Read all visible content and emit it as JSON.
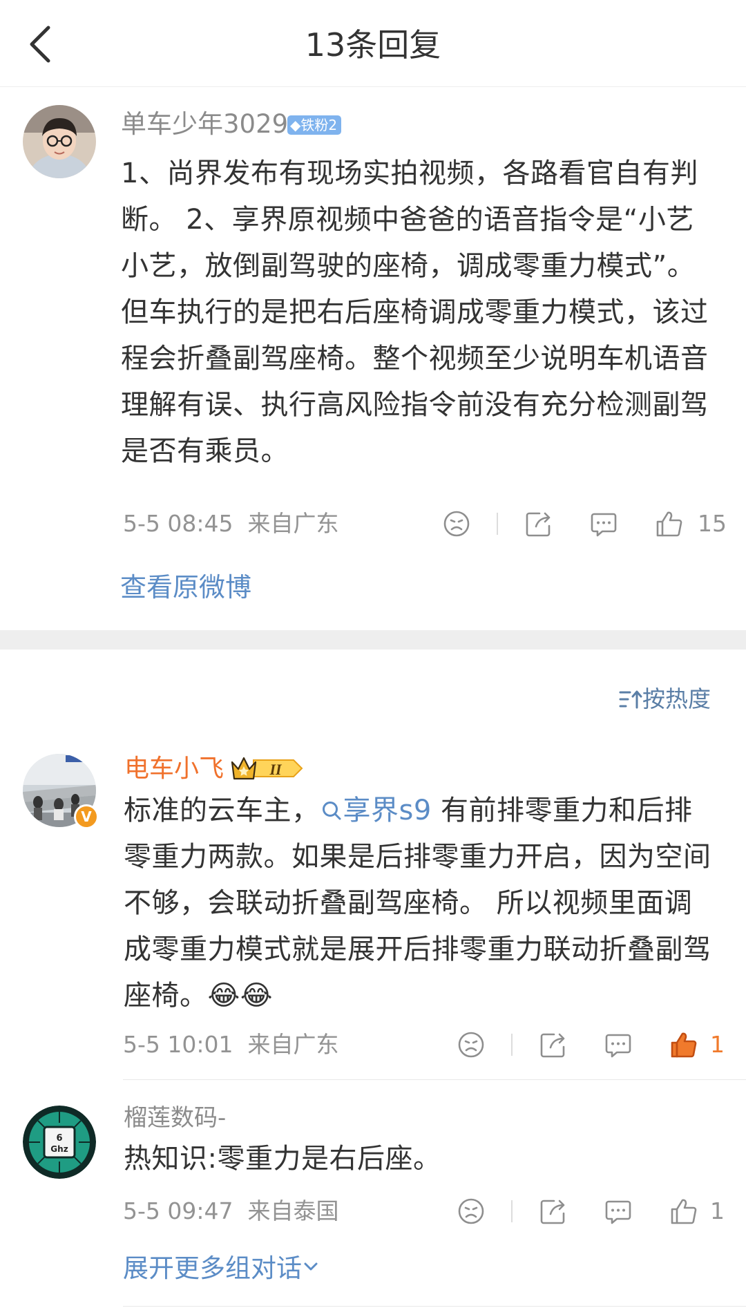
{
  "header": {
    "title": "13条回复"
  },
  "main_post": {
    "username": "单车少年3029",
    "fan_badge": "铁粉2",
    "text": "1、尚界发布有现场实拍视频，各路看官自有判断。 2、享界原视频中爸爸的语音指令是“小艺小艺，放倒副驾驶的座椅，调成零重力模式”。但车执行的是把右后座椅调成零重力模式，该过程会折叠副驾座椅。整个视频至少说明车机语音理解有误、执行高风险指令前没有充分检测副驾是否有乘员。",
    "time": "5-5 08:45",
    "location": "来自广东",
    "like_count": "15",
    "view_original": "查看原微博"
  },
  "sort_label": "按热度",
  "replies": [
    {
      "username": "电车小飞",
      "level_badge": "II",
      "text_before": "标准的云车主，",
      "topic": "享界s9",
      "text_after": " 有前排零重力和后排零重力两款。如果是后排零重力开启，因为空间不够，会联动折叠副驾座椅。 所以视频里面调成零重力模式就是展开后排零重力联动折叠副驾座椅。",
      "emoji": "😂😂",
      "time": "5-5 10:01",
      "location": "来自广东",
      "like_count": "1",
      "liked": true
    },
    {
      "username": "榴莲数码-",
      "text": "热知识:零重力是右后座。",
      "avatar_text": "6 Ghz",
      "time": "5-5 09:47",
      "location": "来自泰国",
      "like_count": "1",
      "liked": false
    }
  ],
  "expand_more": "展开更多组对话",
  "colors": {
    "accent_blue": "#5b8cc6",
    "orange_name": "#f0712c",
    "liked_orange": "#f07a2c",
    "gray_text": "#939393"
  }
}
